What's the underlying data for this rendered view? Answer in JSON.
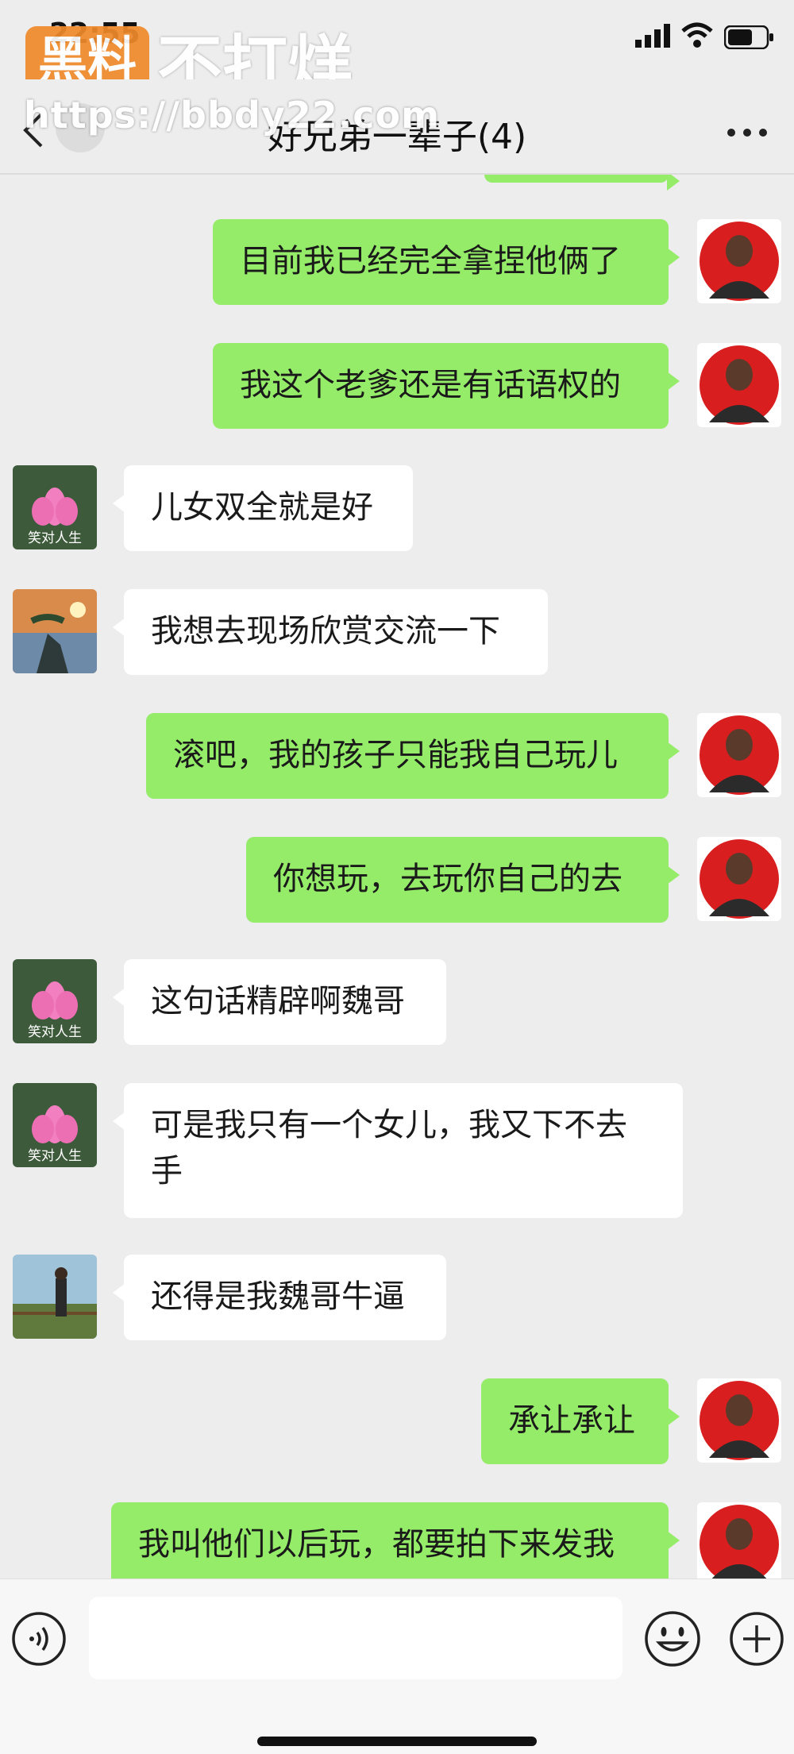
{
  "status_bar": {
    "time": "22:55"
  },
  "watermark": {
    "badge": "黑料",
    "text": "不打烊",
    "url": "https://bbdy22.com"
  },
  "header": {
    "title": "好兄弟一辈子(4)"
  },
  "messages": [
    {
      "side": "me",
      "text": "目前我已经完全拿捏他俩了"
    },
    {
      "side": "me",
      "text": "我这个老爹还是有话语权的"
    },
    {
      "side": "other",
      "avatar": "lotus",
      "text": "儿女双全就是好"
    },
    {
      "side": "other",
      "avatar": "landscape",
      "text": "我想去现场欣赏交流一下"
    },
    {
      "side": "me",
      "text": "滚吧，我的孩子只能我自己玩儿"
    },
    {
      "side": "me",
      "text": "你想玩，去玩你自己的去"
    },
    {
      "side": "other",
      "avatar": "lotus",
      "text": "这句话精辟啊魏哥"
    },
    {
      "side": "other",
      "avatar": "lotus",
      "text": "可是我只有一个女儿，我又下不去手"
    },
    {
      "side": "other",
      "avatar": "person",
      "text": "还得是我魏哥牛逼"
    },
    {
      "side": "me",
      "text": "承让承让"
    },
    {
      "side": "me",
      "text": "我叫他们以后玩，都要拍下来发我"
    }
  ],
  "avatar_caption": "笑对人生",
  "colors": {
    "bubble_me": "#95ec69",
    "bubble_other": "#ffffff",
    "background": "#ededed"
  }
}
